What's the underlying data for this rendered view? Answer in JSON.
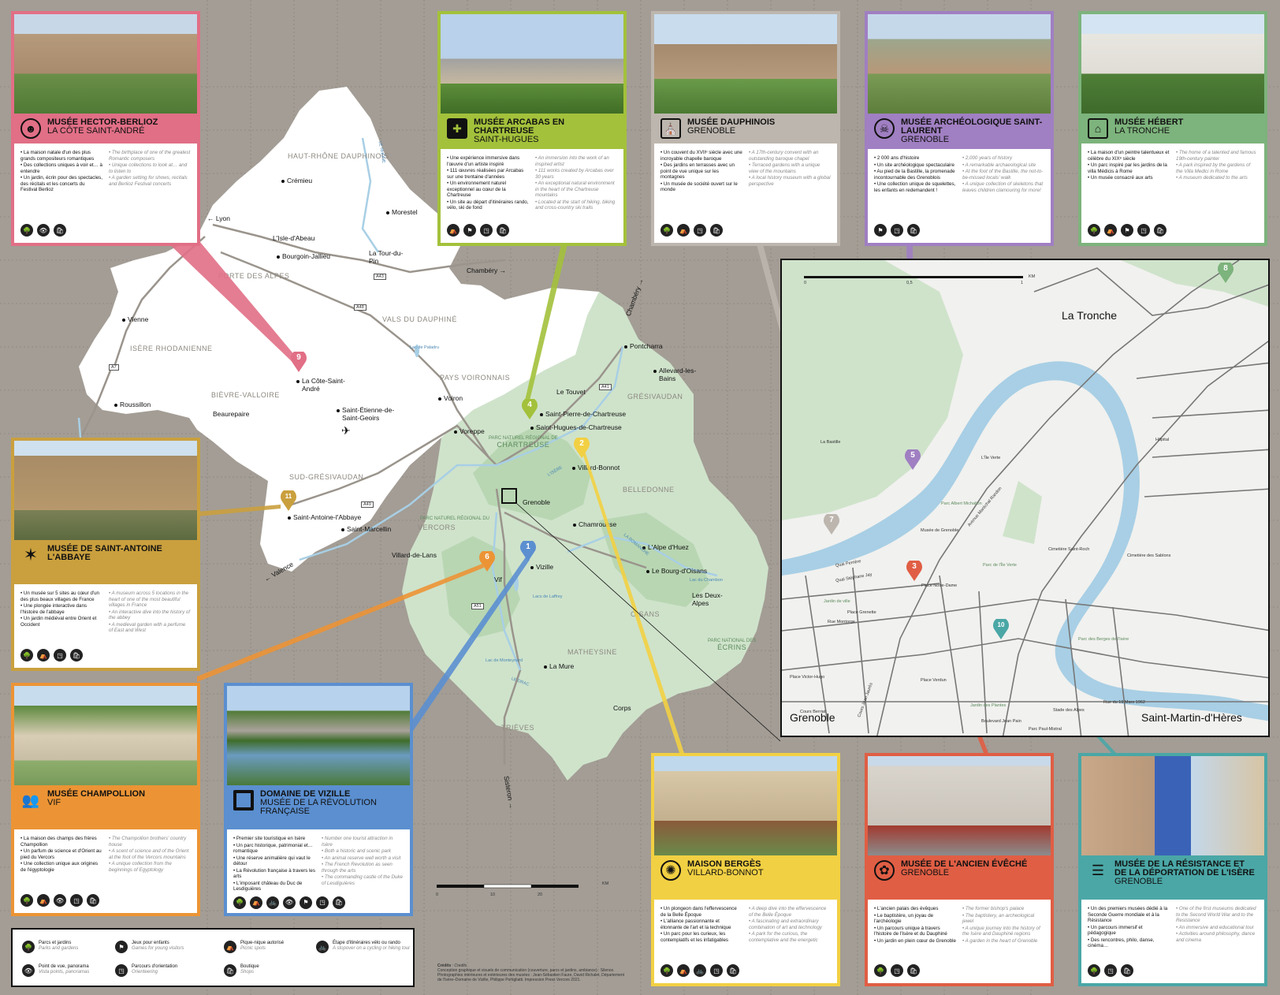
{
  "colors": {
    "background": "#a39d95",
    "berlioz": "#e16f86",
    "arcabas": "#a3c13b",
    "dauphinois": "#bdb6ae",
    "saint_laurent": "#a07fc2",
    "hebert": "#7db37c",
    "saint_antoine": "#caa03e",
    "champollion": "#ec9435",
    "vizille": "#5b8fd0",
    "berges": "#f2d043",
    "eveche": "#e05e44",
    "resistance": "#4aa7a6"
  },
  "cards": {
    "berlioz": {
      "title": "Musée Hector-Berlioz",
      "loc": "La Côte Saint-André",
      "icon": "bust-icon",
      "fr": [
        "La maison natale d'un des plus grands compositeurs romantiques",
        "Des collections uniques à voir et… à entendre",
        "Un jardin, écrin pour des spectacles, des récitals et les concerts du Festival Berlioz"
      ],
      "en": [
        "The birthplace of one of the greatest Romantic composers",
        "Unique collections to look at… and to listen to",
        "A garden setting for shows, recitals and Berlioz Festival concerts"
      ],
      "icons": [
        "🌳",
        "👁",
        "🛍"
      ]
    },
    "arcabas": {
      "title": "Musée Arcabas en Chartreuse",
      "loc": "Saint-Hugues",
      "icon": "cross-icon",
      "fr": [
        "Une expérience immersive dans l'œuvre d'un artiste inspiré",
        "111 œuvres réalisées par Arcabas sur une trentaine d'années",
        "Un environnement naturel exceptionnel au cœur de la Chartreuse",
        "Un site au départ d'itinéraires rando, vélo, ski de fond"
      ],
      "en": [
        "An immersion into the work of an inspired artist",
        "111 works created by Arcabas over 30 years",
        "An exceptional natural environment in the heart of the Chartreuse mountains",
        "Located at the start of hiking, biking and cross-country ski trails"
      ],
      "icons": [
        "⛺",
        "⚑",
        "◳",
        "🛍"
      ]
    },
    "dauphinois": {
      "title": "Musée Dauphinois",
      "loc": "Grenoble",
      "icon": "chapel-icon",
      "fr": [
        "Un couvent du XVIIᵉ siècle avec une incroyable chapelle baroque",
        "Des jardins en terrasses avec un point de vue unique sur les montagnes",
        "Un musée de société ouvert sur le monde"
      ],
      "en": [
        "A 17th-century convent with an outstanding baroque chapel",
        "Terraced gardens with a unique view of the mountains",
        "A local history museum with a global perspective"
      ],
      "icons": [
        "🌳",
        "⛺",
        "◳",
        "🛍"
      ]
    },
    "saint_laurent": {
      "title": "Musée Archéologique Saint-Laurent",
      "loc": "Grenoble",
      "icon": "skull-icon",
      "fr": [
        "2 000 ans d'histoire",
        "Un site archéologique spectaculaire",
        "Au pied de la Bastille, la promenade incontournable des Grenoblois",
        "Une collection unique de squelettes, les enfants en redemandent !"
      ],
      "en": [
        "2,000 years of history",
        "A remarkable archaeological site",
        "At the foot of the Bastille, the not-to-be-missed locals' walk",
        "A unique collection of skeletons that leaves children clamouring for more!"
      ],
      "icons": [
        "⚑",
        "◳",
        "🛍"
      ]
    },
    "hebert": {
      "title": "Musée Hébert",
      "loc": "La Tronche",
      "icon": "villa-icon",
      "fr": [
        "La maison d'un peintre talentueux et célèbre du XIXᵉ siècle",
        "Un parc inspiré par les jardins de la villa Médicis à Rome",
        "Un musée consacré aux arts"
      ],
      "en": [
        "The home of a talented and famous 19th-century painter",
        "A park inspired by the gardens of the Villa Medici in Rome",
        "A museum dedicated to the arts"
      ],
      "icons": [
        "🌳",
        "⛺",
        "⚑",
        "◳",
        "🛍"
      ]
    },
    "saint_antoine": {
      "title": "Musée de Saint-Antoine l'Abbaye",
      "loc": "",
      "icon": "star-icon",
      "fr": [
        "Un musée sur 5 sites au cœur d'un des plus beaux villages de France",
        "Une plongée interactive dans l'histoire de l'abbaye",
        "Un jardin médiéval entre Orient et Occident"
      ],
      "en": [
        "A museum across 5 locations in the heart of one of the most beautiful villages in France",
        "An interactive dive into the history of the abbey",
        "A medieval garden with a perfume of East and West"
      ],
      "icons": [
        "🌳",
        "⛺",
        "◳",
        "🛍"
      ]
    },
    "champollion": {
      "title": "Musée Champollion",
      "loc": "Vif",
      "icon": "couple-icon",
      "fr": [
        "La maison des champs des frères Champollion",
        "Un parfum de science et d'Orient au pied du Vercors",
        "Une collection unique aux origines de l'égyptologie"
      ],
      "en": [
        "The Champollion brothers' country house",
        "A scent of science and of the Orient at the foot of the Vercors mountains",
        "A unique collection from the beginnings of Egyptology"
      ],
      "icons": [
        "🌳",
        "⛺",
        "👁",
        "◳",
        "🛍"
      ]
    },
    "vizille": {
      "title": "Domaine de Vizille",
      "loc": "Musée de la Révolution française",
      "icon": "square-icon",
      "fr": [
        "Premier site touristique en Isère",
        "Un parc historique, patrimonial et… romantique",
        "Une réserve animalière qui vaut le détour",
        "La Révolution française à travers les arts",
        "L'imposant château du Duc de Lesdiguières"
      ],
      "en": [
        "Number one tourist attraction in Isère",
        "Both a historic and scenic park",
        "An animal reserve well worth a visit",
        "The French Revolution as seen through the arts",
        "The commanding castle of the Duke of Lesdiguières"
      ],
      "icons": [
        "🌳",
        "⛺",
        "🚲",
        "👁",
        "⚑",
        "◳",
        "🛍"
      ]
    },
    "berges": {
      "title": "Maison Bergès",
      "loc": "Villard-Bonnot",
      "icon": "wheel-icon",
      "fr": [
        "Un plongeon dans l'effervescence de la Belle Époque",
        "L'alliance passionnante et étonnante de l'art et la technique",
        "Un parc pour les curieux, les contemplatifs et les infatigables"
      ],
      "en": [
        "A deep dive into the effervescence of the Belle Époque",
        "A fascinating and extraordinary combination of art and technology",
        "A park for the curious, the contemplative and the energetic"
      ],
      "icons": [
        "🌳",
        "⛺",
        "🚲",
        "◳",
        "🛍"
      ]
    },
    "eveche": {
      "title": "Musée de l'Ancien Évêché",
      "loc": "Grenoble",
      "icon": "flower-icon",
      "fr": [
        "L'ancien palais des évêques",
        "Le baptistère, un joyau de l'archéologie",
        "Un parcours unique à travers l'histoire de l'Isère et du Dauphiné",
        "Un jardin en plein cœur de Grenoble"
      ],
      "en": [
        "The former bishop's palace",
        "The baptistery, an archeological jewel",
        "A unique journey into the history of the Isère and Dauphiné regions",
        "A garden in the heart of Grenoble"
      ],
      "icons": [
        "🌳",
        "◳",
        "🛍"
      ]
    },
    "resistance": {
      "title": "Musée de la Résistance et de la Déportation de l'Isère",
      "loc": "Grenoble",
      "icon": "stripes-icon",
      "fr": [
        "Un des premiers musées dédié à la Seconde Guerre mondiale et à la Résistance",
        "Un parcours immersif et pédagogique",
        "Des rencontres, philo, danse, cinéma…"
      ],
      "en": [
        "One of the first museums dedicated to the Second World War and to the Resistance",
        "An immersive and educational tour",
        "Activities around philosophy, dance and cinema"
      ],
      "icons": [
        "🌳",
        "◳",
        "🛍"
      ]
    }
  },
  "map": {
    "regions": [
      "HAUT-RHÔNE DAUPHINOIS",
      "PORTE DES ALPES",
      "VALS DU DAUPHINÉ",
      "ISÈRE RHODANIENNE",
      "BIÈVRE-VALLOIRE",
      "PAYS VOIRONNAIS",
      "SUD-GRÉSIVAUDAN",
      "GRÉSIVAUDAN",
      "BELLEDONNE",
      "VERCORS",
      "OISANS",
      "MATHEYSINE",
      "TRIÈVES"
    ],
    "towns": [
      "Crémieu",
      "Morestel",
      "L'Isle-d'Abeau",
      "Bourgoin-Jallieu",
      "La Tour-du-Pin",
      "Vienne",
      "Roussillon",
      "La Côte-Saint-André",
      "Beaurepaire",
      "Saint-Étienne-de-Saint-Geoirs",
      "Voiron",
      "Voreppe",
      "Le Touvet",
      "Saint-Pierre-de-Chartreuse",
      "Saint-Hugues-de-Chartreuse",
      "Villard-Bonnot",
      "Pontcharra",
      "Allevard-les-Bains",
      "Grenoble",
      "Chamrousse",
      "Vizille",
      "Vif",
      "Villard-de-Lans",
      "L'Alpe d'Huez",
      "Le Bourg-d'Oisans",
      "Les Deux-Alpes",
      "La Mure",
      "Corps",
      "Saint-Antoine-l'Abbaye",
      "Saint-Marcellin"
    ],
    "directions": [
      "Lyon",
      "Chambéry",
      "Chambéry",
      "Valence",
      "Sisteron"
    ],
    "roads": [
      "A43",
      "A48",
      "A7",
      "A41",
      "A49",
      "A51"
    ],
    "parks": [
      {
        "small": "PARC NATUREL RÉGIONAL DE",
        "name": "CHARTREUSE"
      },
      {
        "small": "PARC NATUREL RÉGIONAL DU",
        "name": "VERCORS"
      },
      {
        "small": "PARC NATIONAL DES",
        "name": "ÉCRINS"
      }
    ],
    "lakes": [
      "Lac de Paladru",
      "Lac du Chambon",
      "Lacs de Laffrey",
      "Lac de Monteynard"
    ],
    "rivers": [
      "LE RHÔNE",
      "L'ISÈRE",
      "LA ROMANCHE",
      "LE DRAC"
    ],
    "scale": {
      "unit": "KM",
      "ticks": [
        "0",
        "10",
        "20"
      ]
    }
  },
  "inset": {
    "cities": [
      "La Tronche",
      "Grenoble",
      "Saint-Martin-d'Hères"
    ],
    "places": [
      "La Bastille",
      "L'Île Verte",
      "Parc Albert Michallon",
      "Musée de Grenoble",
      "Cimetière Saint-Roch",
      "Cimetière des Sablons",
      "Hôpital",
      "Place Notre-Dame",
      "Jardin de ville",
      "Place Grenette",
      "Place Victor-Hugo",
      "Place Verdun",
      "Jardin des Plantes",
      "Parc Paul-Mistral",
      "Stade des Alpes",
      "Parc des Berges de l'Isère",
      "Parc de l'Île Verte"
    ],
    "streets": [
      "Quai Perrière",
      "Quai Stéphane Jay",
      "Rue Montorge",
      "Cours Jean Jaurès",
      "Avenue Maréchal Randon",
      "Cours Berriat",
      "Rue du 19 Mars 1962",
      "Boulevard Jean Pain"
    ],
    "scale": {
      "unit": "KM",
      "ticks": [
        "0",
        "0,5",
        "1"
      ]
    }
  },
  "pins": [
    "1",
    "2",
    "3",
    "4",
    "5",
    "6",
    "7",
    "8",
    "9",
    "10",
    "11"
  ],
  "legend": [
    {
      "icon": "tree-icon",
      "fr": "Parcs et jardins",
      "en": "Parks and gardens"
    },
    {
      "icon": "play-icon",
      "fr": "Jeux pour enfants",
      "en": "Games for young visitors"
    },
    {
      "icon": "picnic-icon",
      "fr": "Pique-nique autorisé",
      "en": "Picnic spots"
    },
    {
      "icon": "bike-icon",
      "fr": "Étape d'itinéraires vélo ou rando",
      "en": "A stopover on a cycling or hiking tour"
    },
    {
      "icon": "eye-icon",
      "fr": "Point de vue, panorama",
      "en": "Vista points, panoramas"
    },
    {
      "icon": "compass-icon",
      "fr": "Parcours d'orientation",
      "en": "Orienteering"
    },
    {
      "icon": "shop-icon",
      "fr": "Boutique",
      "en": "Shops"
    }
  ],
  "credits": {
    "title": "Crédits",
    "title_en": "Credits",
    "text": "Conception graphique et visuels de communication (couverture, parcs et jardins, ambiance) : Silence. Photographies intérieures et extérieures des musées : Jean-Sébastien Faure, David Richalet, Département de l'Isère–Domaine de Vizille, Philippe Portigliatti. Impression Press Vercors 2021."
  }
}
